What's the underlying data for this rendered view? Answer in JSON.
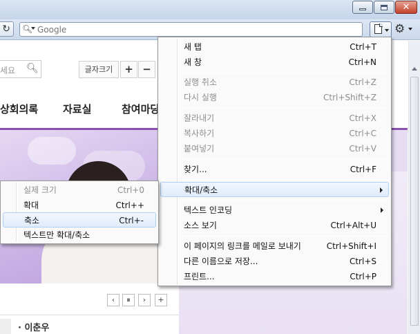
{
  "toolbar": {
    "search_placeholder": "Google",
    "search_icon": "magnifier-icon",
    "page_menu_icon": "page-icon",
    "tools_menu_icon": "gear-icon",
    "reload_icon": "refresh-icon"
  },
  "site": {
    "search_placeholder_fragment": "세요",
    "font_size_label": "글자크기",
    "font_size_plus": "+",
    "font_size_minus": "−",
    "nav": [
      "상회의록",
      "자료실",
      "참여마당"
    ],
    "pager": [
      "‹",
      "⏸",
      "›",
      "+"
    ],
    "news_item": "· 이춘우"
  },
  "page_menu": {
    "items": [
      {
        "label": "새 탭",
        "shortcut": "Ctrl+T",
        "disabled": false
      },
      {
        "label": "새 창",
        "shortcut": "Ctrl+N",
        "disabled": false
      },
      {
        "label": "실행 취소",
        "shortcut": "Ctrl+Z",
        "disabled": true
      },
      {
        "label": "다시 실행",
        "shortcut": "Ctrl+Shift+Z",
        "disabled": true
      },
      {
        "label": "잘라내기",
        "shortcut": "Ctrl+X",
        "disabled": true
      },
      {
        "label": "복사하기",
        "shortcut": "Ctrl+C",
        "disabled": true
      },
      {
        "label": "붙여넣기",
        "shortcut": "Ctrl+V",
        "disabled": true
      },
      {
        "label": "찾기...",
        "shortcut": "Ctrl+F",
        "disabled": false
      },
      {
        "label": "확대/축소",
        "shortcut": "",
        "submenu": true,
        "highlighted": true
      },
      {
        "label": "텍스트 인코딩",
        "shortcut": "",
        "submenu": true
      },
      {
        "label": "소스 보기",
        "shortcut": "Ctrl+Alt+U",
        "disabled": false
      },
      {
        "label": "이 페이지의 링크를 메일로 보내기",
        "shortcut": "Ctrl+Shift+I",
        "disabled": false
      },
      {
        "label": "다른 이름으로 저장...",
        "shortcut": "Ctrl+S",
        "disabled": false
      },
      {
        "label": "프린트...",
        "shortcut": "Ctrl+P",
        "disabled": false
      }
    ]
  },
  "zoom_submenu": {
    "items": [
      {
        "label": "실제 크기",
        "shortcut": "Ctrl+0",
        "disabled": true
      },
      {
        "label": "확대",
        "shortcut": "Ctrl++",
        "disabled": false
      },
      {
        "label": "축소",
        "shortcut": "Ctrl+-",
        "highlighted": true
      },
      {
        "label": "텍스트만 확대/축소",
        "shortcut": "",
        "disabled": false
      }
    ]
  }
}
